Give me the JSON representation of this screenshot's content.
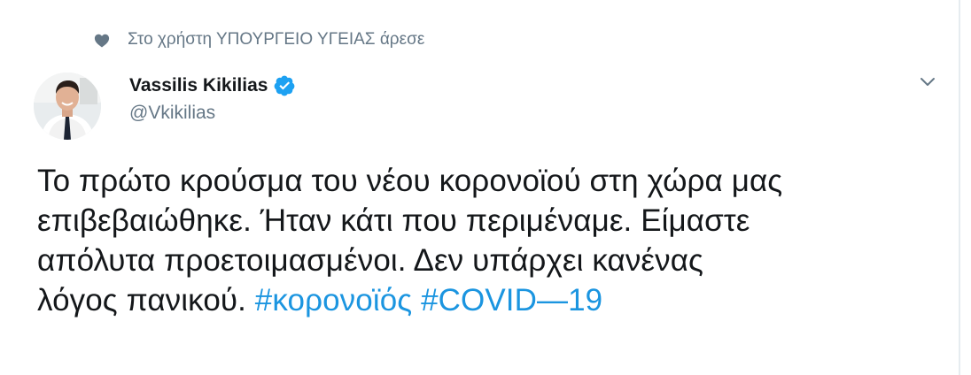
{
  "social_context": {
    "text": "Στο χρήστη ΥΠΟΥΡΓΕΙΟ ΥΓΕΙΑΣ άρεσε",
    "icon": "heart-icon"
  },
  "author": {
    "display_name": "Vassilis Kikilias",
    "handle": "@Vkikilias",
    "verified": true
  },
  "tweet": {
    "line1": "Το πρώτο κρούσμα του νέου κορονοϊού στη χώρα μας",
    "line2": "επιβεβαιώθηκε. Ήταν κάτι που περιμέναμε. Είμαστε",
    "line3": "απόλυτα προετοιμασμένοι. Δεν υπάρχει κανένας",
    "line4": "λόγος πανικού.",
    "hashtag1": "#κορονοϊός",
    "hashtag2": "#COVID—19"
  },
  "colors": {
    "text": "#14171a",
    "secondary": "#657786",
    "link": "#1b95e0",
    "verified": "#1da1f2"
  }
}
